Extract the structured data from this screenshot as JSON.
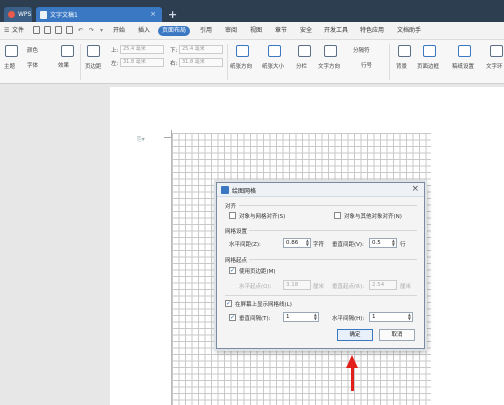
{
  "tabs": {
    "wps_label": "WPS",
    "doc_label": "文字文稿1",
    "close_glyph": "×",
    "add_glyph": "+"
  },
  "menu": {
    "file": "文件",
    "items": [
      "开始",
      "插入",
      "页面布局",
      "引用",
      "审阅",
      "视图",
      "章节",
      "安全",
      "开发工具",
      "特色应用",
      "文档助手"
    ],
    "active_index": 2
  },
  "ribbon": {
    "theme": "主题",
    "colors": "颜色",
    "fonts": "字体",
    "effects": "效果",
    "margins": "页边距",
    "top_label": "上:",
    "top_value": "25.4 毫米",
    "bottom_label": "下:",
    "bottom_value": "25.4 毫米",
    "left_label": "左:",
    "left_value": "31.8 毫米",
    "right_label": "右:",
    "right_value": "31.8 毫米",
    "orientation": "纸张方向",
    "size": "纸张大小",
    "columns": "分栏",
    "text_direction": "文字方向",
    "line_numbers": "行号",
    "breaks": "分隔符",
    "background": "背景",
    "page_border": "页面边框",
    "manuscript": "稿纸设置",
    "wrap": "文字环"
  },
  "dialog": {
    "title": "绘图网格",
    "close_glyph": "×",
    "align_section": "对齐",
    "snap_to_grid": "对象与网格对齐(S)",
    "snap_to_objects": "对象与其他对象对齐(N)",
    "grid_settings_section": "网格设置",
    "h_spacing_label": "水平间距(Z):",
    "h_spacing_value": "0.86",
    "h_spacing_unit": "字符",
    "v_spacing_label": "垂直间距(V):",
    "v_spacing_value": "0.5",
    "v_spacing_unit": "行",
    "grid_origin_section": "网格起点",
    "use_margins": "使用页边距(M)",
    "h_origin_label": "水平起点(O):",
    "h_origin_value": "3.18",
    "h_origin_unit": "厘米",
    "v_origin_label": "垂直起点(R):",
    "v_origin_value": "2.54",
    "v_origin_unit": "厘米",
    "show_gridlines": "在屏幕上显示网格线(L)",
    "vertical_every_label": "垂直间隔(T):",
    "vertical_every_value": "1",
    "horizontal_every_label": "水平间隔(H):",
    "horizontal_every_value": "1",
    "ok": "确定",
    "cancel": "取消"
  }
}
